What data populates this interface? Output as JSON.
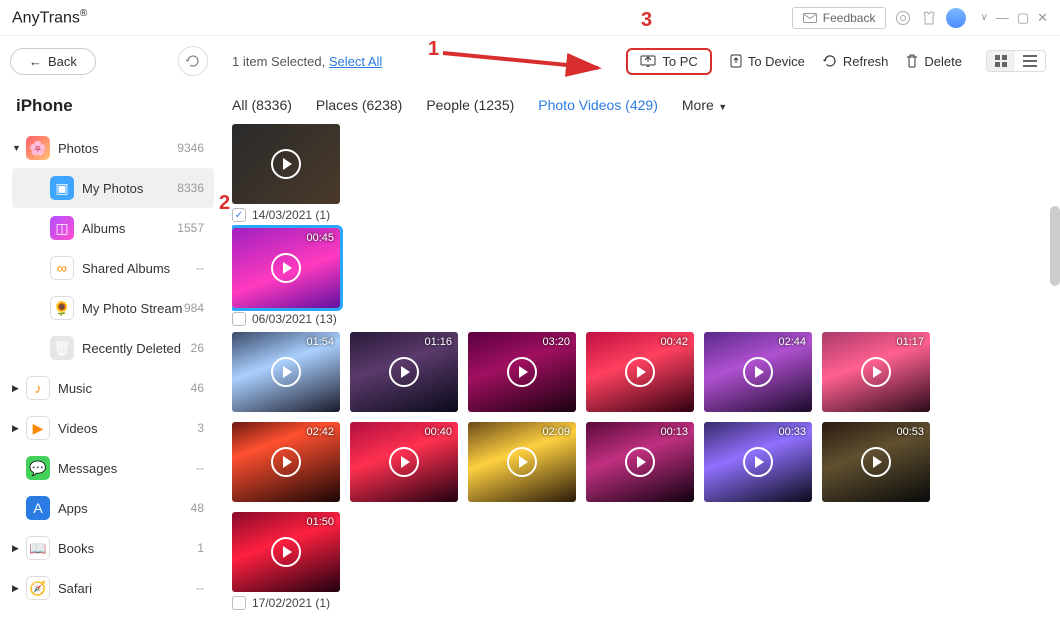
{
  "app": {
    "title": "AnyTrans",
    "mark": "®"
  },
  "topbar": {
    "feedback": "Feedback"
  },
  "header": {
    "back": "Back",
    "selected_prefix": "1 item Selected, ",
    "select_all": "Select All",
    "to_pc": "To PC",
    "to_device": "To Device",
    "refresh": "Refresh",
    "delete": "Delete"
  },
  "device": "iPhone",
  "sidebar": [
    {
      "label": "Photos",
      "count": "9346",
      "icon": "flower",
      "bg": "linear-gradient(135deg,#ff5f6d,#ffc371)",
      "caret": "▼"
    },
    {
      "label": "My Photos",
      "count": "8336",
      "icon": "photo",
      "bg": "#3fa6ff",
      "indent": true,
      "active": true
    },
    {
      "label": "Albums",
      "count": "1557",
      "icon": "album",
      "bg": "linear-gradient(135deg,#b24fff,#ff4fcf)",
      "indent": true
    },
    {
      "label": "Shared Albums",
      "count": "--",
      "icon": "share",
      "bg": "#fff",
      "indent": true
    },
    {
      "label": "My Photo Stream",
      "count": "984",
      "icon": "sunflower",
      "bg": "#fff",
      "indent": true
    },
    {
      "label": "Recently Deleted",
      "count": "26",
      "icon": "trash",
      "bg": "#e6e6e6",
      "indent": true
    },
    {
      "label": "Music",
      "count": "46",
      "icon": "music",
      "bg": "#fff",
      "caret": "▶"
    },
    {
      "label": "Videos",
      "count": "3",
      "icon": "video",
      "bg": "#fff",
      "caret": "▶"
    },
    {
      "label": "Messages",
      "count": "--",
      "icon": "msg",
      "bg": "#43d15b"
    },
    {
      "label": "Apps",
      "count": "48",
      "icon": "apps",
      "bg": "#2a7be4"
    },
    {
      "label": "Books",
      "count": "1",
      "icon": "book",
      "bg": "#fff",
      "caret": "▶"
    },
    {
      "label": "Safari",
      "count": "--",
      "icon": "safari",
      "bg": "#fff",
      "caret": "▶"
    }
  ],
  "tabs": {
    "all": "All (8336)",
    "places": "Places (6238)",
    "people": "People (1235)",
    "photo_videos": "Photo Videos (429)",
    "more": "More"
  },
  "groups": [
    {
      "date": "",
      "checked": false,
      "items": [
        {
          "dur": "",
          "bg": "linear-gradient(135deg,#2a2a2a,#4a3a2a)",
          "hasHeader": false
        }
      ],
      "noHeader": true
    },
    {
      "date": "14/03/2021 (1)",
      "checked": true,
      "items": [
        {
          "dur": "00:45",
          "bg": "linear-gradient(160deg,#a020c0,#ff3abf 55%,#6010a0)",
          "sel": true
        }
      ]
    },
    {
      "date": "06/03/2021 (13)",
      "checked": false,
      "items": [
        {
          "dur": "01:54",
          "bg": "linear-gradient(160deg,#3a4a6a,#aad0ff 40%,#1a1a2a)"
        },
        {
          "dur": "01:16",
          "bg": "linear-gradient(160deg,#2a1a3a,#5a3a6a 40%,#0a0a1a)"
        },
        {
          "dur": "03:20",
          "bg": "linear-gradient(160deg,#5a0040,#a01060 40%,#1a0010)"
        },
        {
          "dur": "00:42",
          "bg": "linear-gradient(160deg,#c01040,#ff4060 40%,#300010)"
        },
        {
          "dur": "02:44",
          "bg": "linear-gradient(160deg,#5a2a8a,#b050d0 40%,#1a0a2a)"
        },
        {
          "dur": "01:17",
          "bg": "linear-gradient(160deg,#aa3a6a,#ff6090 40%,#2a0a1a)"
        },
        {
          "dur": "02:42",
          "bg": "linear-gradient(160deg,#6a1a10,#ff5030 30%,#1a0505)"
        },
        {
          "dur": "00:40",
          "bg": "linear-gradient(160deg,#b01040,#ff3050 40%,#200010)"
        },
        {
          "dur": "02:09",
          "bg": "linear-gradient(160deg,#6a4a1a,#ffd040 40%,#2a1a0a)"
        },
        {
          "dur": "00:13",
          "bg": "linear-gradient(160deg,#5a0a3a,#c03080 40%,#100010)"
        },
        {
          "dur": "00:33",
          "bg": "linear-gradient(160deg,#3a2a6a,#9070ff 40%,#0a0a1a)"
        },
        {
          "dur": "00:53",
          "bg": "linear-gradient(160deg,#2a1a10,#605030 40%,#0a0a0a)"
        },
        {
          "dur": "01:50",
          "bg": "linear-gradient(160deg,#8a0a2a,#ff2040 40%,#200010)"
        }
      ]
    },
    {
      "date": "17/02/2021 (1)",
      "checked": false,
      "items": []
    }
  ],
  "annotations": {
    "n1": "1",
    "n2": "2",
    "n3": "3"
  }
}
